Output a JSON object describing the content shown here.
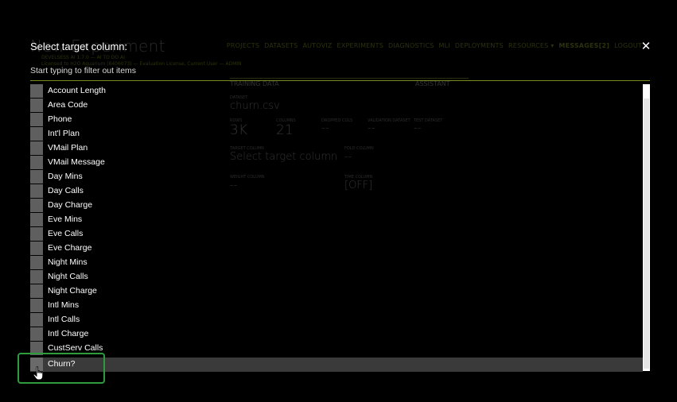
{
  "background": {
    "title": "New Experiment",
    "version": "DEVELSESS AI 1.7.0 — AI TO DO AI",
    "license": "Licensed to H2O Aquarium (8406073) — Evaluation License, Current User — ADMIN",
    "nav": [
      "PROJECTS",
      "DATASETS",
      "AUTOVIZ",
      "EXPERIMENTS",
      "DIAGNOSTICS",
      "MLI",
      "DEPLOYMENTS",
      "RESOURCES ▾",
      "MESSAGES[2]",
      "LOGOUT"
    ],
    "section": "TRAINING DATA",
    "assistant": "ASSISTANT",
    "dataset_label": "DATASET",
    "dataset_value": "churn.csv",
    "rows_label": "ROWS",
    "rows_value": "3K",
    "columns_label": "COLUMNS",
    "columns_value": "21",
    "dropped_label": "DROPPED COLS",
    "dropped_value": "--",
    "validation_label": "VALIDATION DATASET",
    "validation_value": "--",
    "test_label": "TEST DATASET",
    "test_value": "--",
    "target_label": "TARGET COLUMN",
    "target_value": "Select target column",
    "fold_label": "FOLD COLUMN",
    "fold_value": "--",
    "weight_label": "WEIGHT COLUMN",
    "weight_value": "--",
    "time_label": "TIME COLUMN",
    "time_value": "[OFF]"
  },
  "dialog": {
    "title": "Select target column:",
    "close": "✕",
    "filter_hint": "Start typing to filter out items",
    "columns": [
      "Account Length",
      "Area Code",
      "Phone",
      "Int'l Plan",
      "VMail Plan",
      "VMail Message",
      "Day Mins",
      "Day Calls",
      "Day Charge",
      "Eve Mins",
      "Eve Calls",
      "Eve Charge",
      "Night Mins",
      "Night Calls",
      "Night Charge",
      "Intl Mins",
      "Intl Calls",
      "Intl Charge",
      "CustServ Calls",
      "Churn?"
    ],
    "selected": "Churn?"
  },
  "colors": {
    "accent": "#c8dd3a",
    "highlight_box": "#2e9b3c",
    "checkbox": "#5f5f5f",
    "selected_row": "#3a3a3a"
  }
}
